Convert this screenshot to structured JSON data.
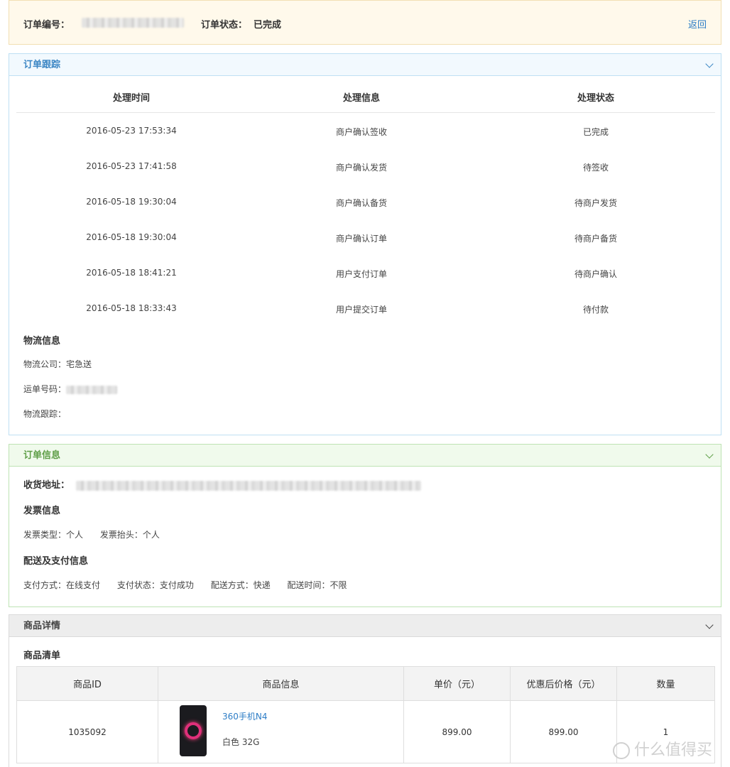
{
  "order_bar": {
    "order_no_label": "订单编号：",
    "status_label": "订单状态：",
    "status_value": "已完成",
    "back_label": "返回"
  },
  "tracking": {
    "title": "订单跟踪",
    "headers": [
      "处理时间",
      "处理信息",
      "处理状态"
    ],
    "rows": [
      {
        "time": "2016-05-23 17:53:34",
        "info": "商户确认签收",
        "status": "已完成"
      },
      {
        "time": "2016-05-23 17:41:58",
        "info": "商户确认发货",
        "status": "待签收"
      },
      {
        "time": "2016-05-18 19:30:04",
        "info": "商户确认备货",
        "status": "待商户发货"
      },
      {
        "time": "2016-05-18 19:30:04",
        "info": "商户确认订单",
        "status": "待商户备货"
      },
      {
        "time": "2016-05-18 18:41:21",
        "info": "用户支付订单",
        "status": "待商户确认"
      },
      {
        "time": "2016-05-18 18:33:43",
        "info": "用户提交订单",
        "status": "待付款"
      }
    ],
    "logistics": {
      "title": "物流信息",
      "company_label": "物流公司：",
      "company_value": "宅急送",
      "waybill_label": "运单号码：",
      "track_label": "物流跟踪："
    }
  },
  "order_info": {
    "title": "订单信息",
    "address_label": "收货地址：",
    "invoice_title": "发票信息",
    "invoice_type": "发票类型：个人",
    "invoice_head": "发票抬头：个人",
    "pay_title": "配送及支付信息",
    "pay_method": "支付方式：在线支付",
    "pay_status": "支付状态：支付成功",
    "ship_method": "配送方式：快递",
    "ship_time": "配送时间：不限"
  },
  "goods": {
    "title": "商品详情",
    "list_title": "商品清单",
    "headers": [
      "商品ID",
      "商品信息",
      "单价（元）",
      "优惠后价格（元）",
      "数量"
    ],
    "item": {
      "id": "1035092",
      "name": "360手机N4",
      "spec": "白色 32G",
      "price": "899.00",
      "discount_price": "899.00",
      "qty": "1"
    }
  },
  "watermark": "什么值得买",
  "colors": {
    "link": "#2d7dc6",
    "tracking_header": "#3b86c4",
    "order_info_header": "#5e9e47",
    "top_bar_bg": "#fff9eb"
  }
}
